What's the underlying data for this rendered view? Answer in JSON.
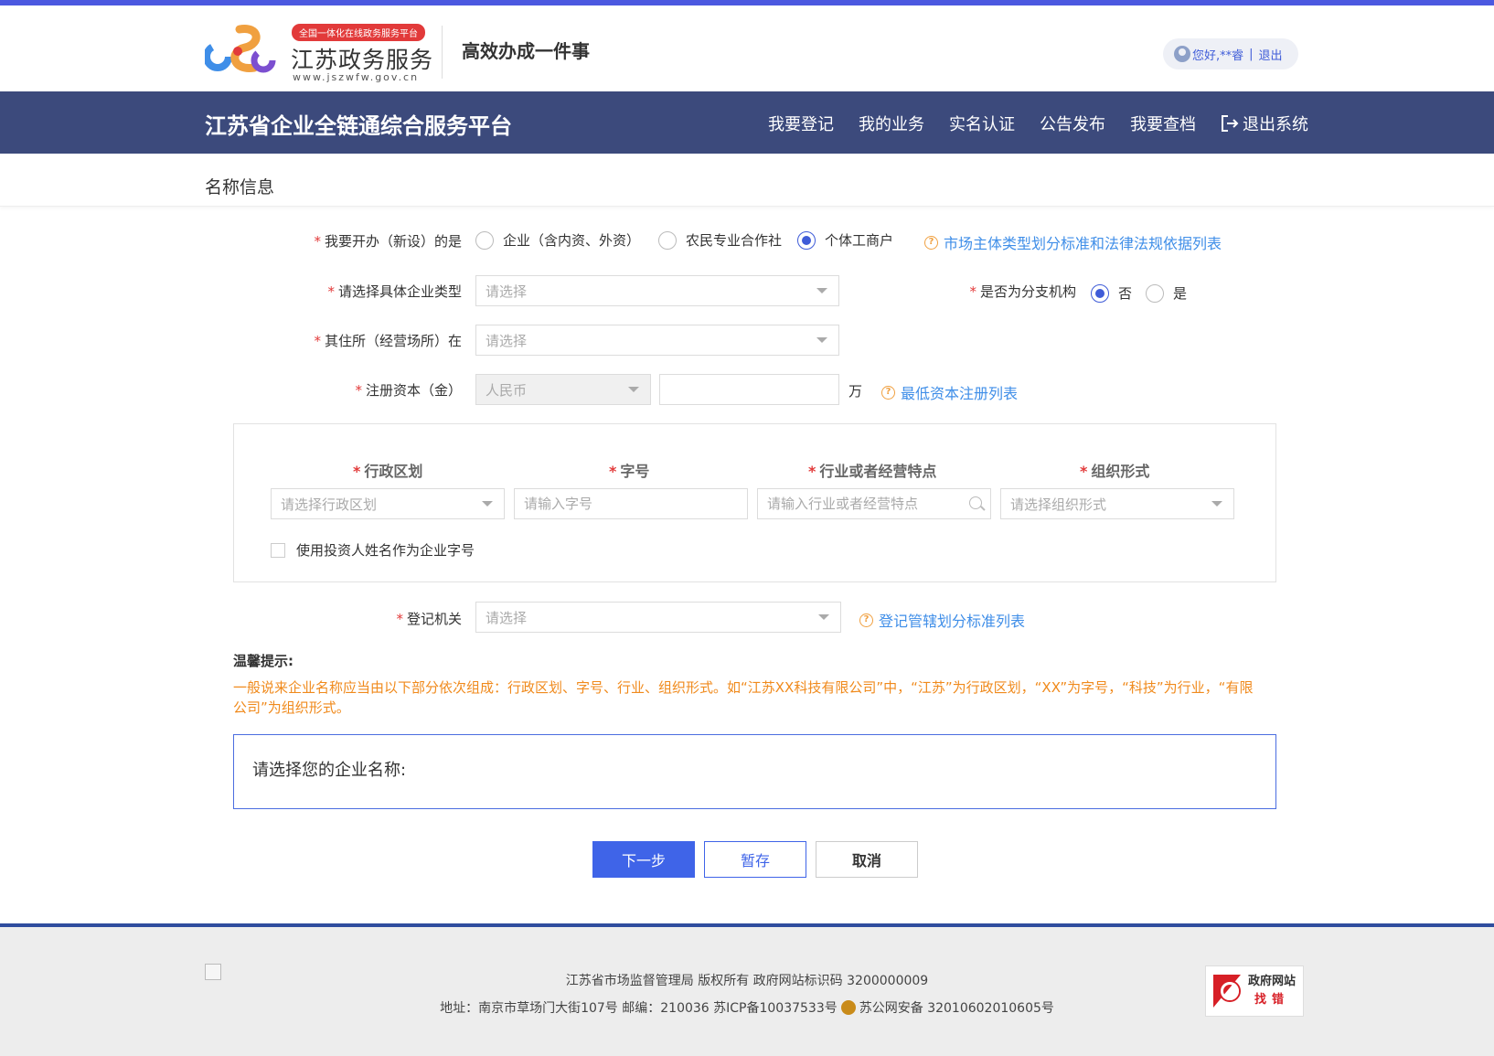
{
  "header": {
    "logo_badge": "全国一体化在线政务服务平台",
    "logo_title": "江苏政务服务",
    "logo_url": "www.jszwfw.gov.cn",
    "slogan": "高效办成一件事",
    "user_greeting": "您好,**睿",
    "logout_link": "退出"
  },
  "navbar": {
    "title": "江苏省企业全链通综合服务平台",
    "items": [
      "我要登记",
      "我的业务",
      "实名认证",
      "公告发布",
      "我要查档",
      "退出系统"
    ]
  },
  "section": {
    "title": "名称信息"
  },
  "form": {
    "entity_type": {
      "label": "我要开办（新设）的是",
      "options": [
        "企业（含内资、外资）",
        "农民专业合作社",
        "个体工商户"
      ],
      "selected": "个体工商户",
      "help_link": "市场主体类型划分标准和法律法规依据列表"
    },
    "company_type": {
      "label": "请选择具体企业类型",
      "placeholder": "请选择"
    },
    "branch": {
      "label": "是否为分支机构",
      "options": [
        "否",
        "是"
      ],
      "selected": "否"
    },
    "residence": {
      "label": "其住所（经营场所）在",
      "placeholder": "请选择"
    },
    "capital": {
      "label": "注册资本（金）",
      "currency": "人民币",
      "amount": "",
      "unit": "万",
      "help_link": "最低资本注册列表"
    },
    "name_parts": {
      "region": {
        "label": "行政区划",
        "placeholder": "请选择行政区划"
      },
      "trade_name": {
        "label": "字号",
        "placeholder": "请输入字号"
      },
      "industry": {
        "label": "行业或者经营特点",
        "placeholder": "请输入行业或者经营特点"
      },
      "org_form": {
        "label": "组织形式",
        "placeholder": "请选择组织形式"
      },
      "use_investor_name": "使用投资人姓名作为企业字号"
    },
    "authority": {
      "label": "登记机关",
      "placeholder": "请选择",
      "help_link": "登记管辖划分标准列表"
    },
    "tips_title": "温馨提示:",
    "tips_text": "一般说来企业名称应当由以下部分依次组成：行政区划、字号、行业、组织形式。如“江苏XX科技有限公司”中，“江苏”为行政区划，“XX”为字号，“科技”为行业，“有限公司”为组织形式。",
    "choose_name_label": "请选择您的企业名称:"
  },
  "buttons": {
    "next": "下一步",
    "save": "暂存",
    "cancel": "取消"
  },
  "footer": {
    "line1": "江苏省市场监督管理局 版权所有 政府网站标识码 3200000009",
    "line2_a": "地址：南京市草场门大街107号 邮编：210036 苏ICP备10037533号",
    "line2_b": "苏公网安备 32010602010605号",
    "find_error_1": "政府网站",
    "find_error_2": "找错"
  },
  "colors": {
    "accent": "#3f64e8",
    "navbar": "#3c4a7c",
    "tips": "#f08a1c",
    "required": "#e23a3a"
  }
}
